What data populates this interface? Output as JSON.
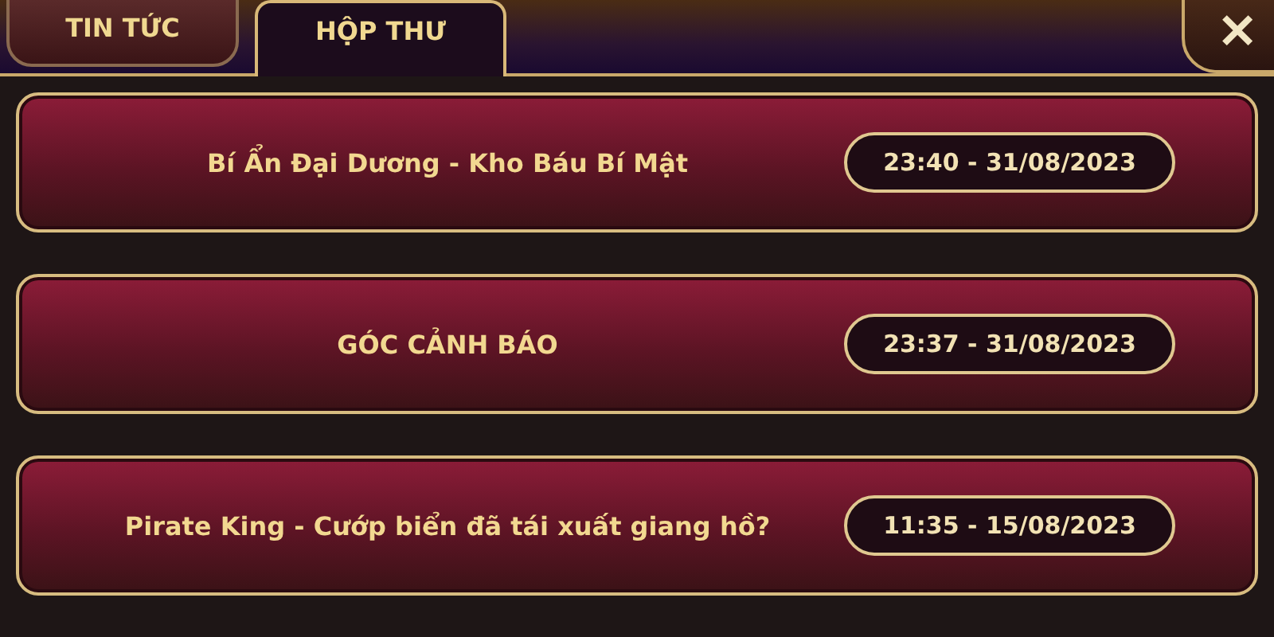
{
  "tabs": [
    {
      "label": "TIN TỨC",
      "selected": false
    },
    {
      "label": "HỘP THƯ",
      "selected": true
    }
  ],
  "close": {
    "label": "✕"
  },
  "messages": [
    {
      "title": "Bí Ẩn Đại Dương - Kho Báu Bí Mật",
      "time": "23:40 - 31/08/2023"
    },
    {
      "title": "GÓC CẢNH BÁO",
      "time": "23:37 - 31/08/2023"
    },
    {
      "title": "Pirate King - Cướp biển đã tái xuất giang hồ?",
      "time": "11:35 - 15/08/2023"
    }
  ]
}
